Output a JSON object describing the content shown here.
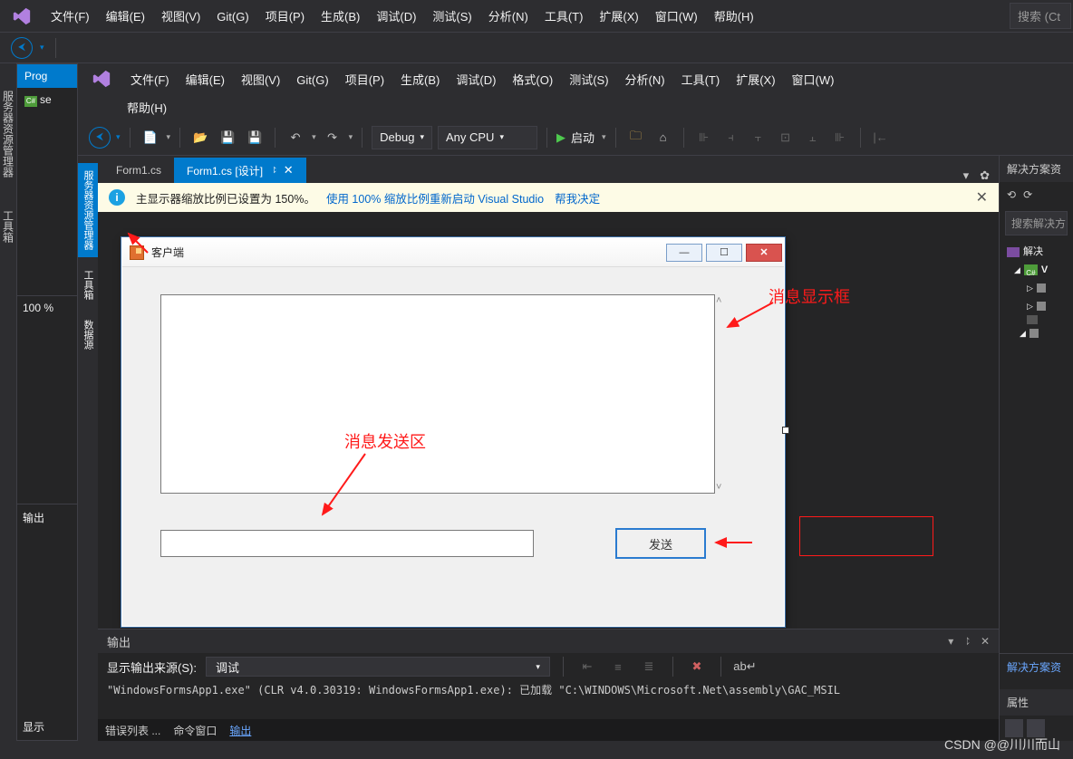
{
  "outer_menu": [
    "文件(F)",
    "编辑(E)",
    "视图(V)",
    "Git(G)",
    "项目(P)",
    "生成(B)",
    "调试(D)",
    "测试(S)",
    "分析(N)",
    "工具(T)",
    "扩展(X)",
    "窗口(W)",
    "帮助(H)"
  ],
  "outer_search_placeholder": "搜索 (Ct",
  "outer_left_tabs": {
    "prog": "Prog",
    "se": "se"
  },
  "outer_bottom_zoom": "100 %",
  "outer_bottom_tabs": [
    "输出",
    "显示"
  ],
  "outer_vertical_tabs": [
    "服务器资源管理器",
    "工具箱"
  ],
  "inner_menu": [
    "文件(F)",
    "编辑(E)",
    "视图(V)",
    "Git(G)",
    "项目(P)",
    "生成(B)",
    "调试(D)",
    "格式(O)",
    "测试(S)",
    "分析(N)",
    "工具(T)",
    "扩展(X)",
    "窗口(W)"
  ],
  "inner_menu_row2": "帮助(H)",
  "inner_toolbar": {
    "config": "Debug",
    "platform": "Any CPU",
    "start": "启动"
  },
  "inner_vertical_tabs": [
    "服务器资源管理器",
    "工具箱",
    "数据源"
  ],
  "doc_tabs": {
    "inactive": "Form1.cs",
    "active": "Form1.cs [设计]"
  },
  "info_bar": {
    "msg": "主显示器缩放比例已设置为 150%。",
    "link1": "使用 100% 缩放比例重新启动 Visual Studio",
    "link2": "帮我决定"
  },
  "winform": {
    "title": "客户端",
    "send": "发送"
  },
  "annotations": {
    "display_box": "消息显示框",
    "send_area": "消息发送区"
  },
  "solution_explorer": {
    "title": "解决方案资",
    "search": "搜索解决方",
    "items": [
      "解决",
      "V"
    ],
    "bottom_tab": "解决方案资"
  },
  "properties": {
    "title": "属性"
  },
  "output": {
    "title": "输出",
    "source_label": "显示输出来源(S):",
    "source_value": "调试",
    "log": "\"WindowsFormsApp1.exe\" (CLR v4.0.30319: WindowsFormsApp1.exe): 已加载 \"C:\\WINDOWS\\Microsoft.Net\\assembly\\GAC_MSIL",
    "tabs": [
      "错误列表 ...",
      "命令窗口",
      "输出"
    ]
  },
  "watermark": "CSDN @@川川而山"
}
